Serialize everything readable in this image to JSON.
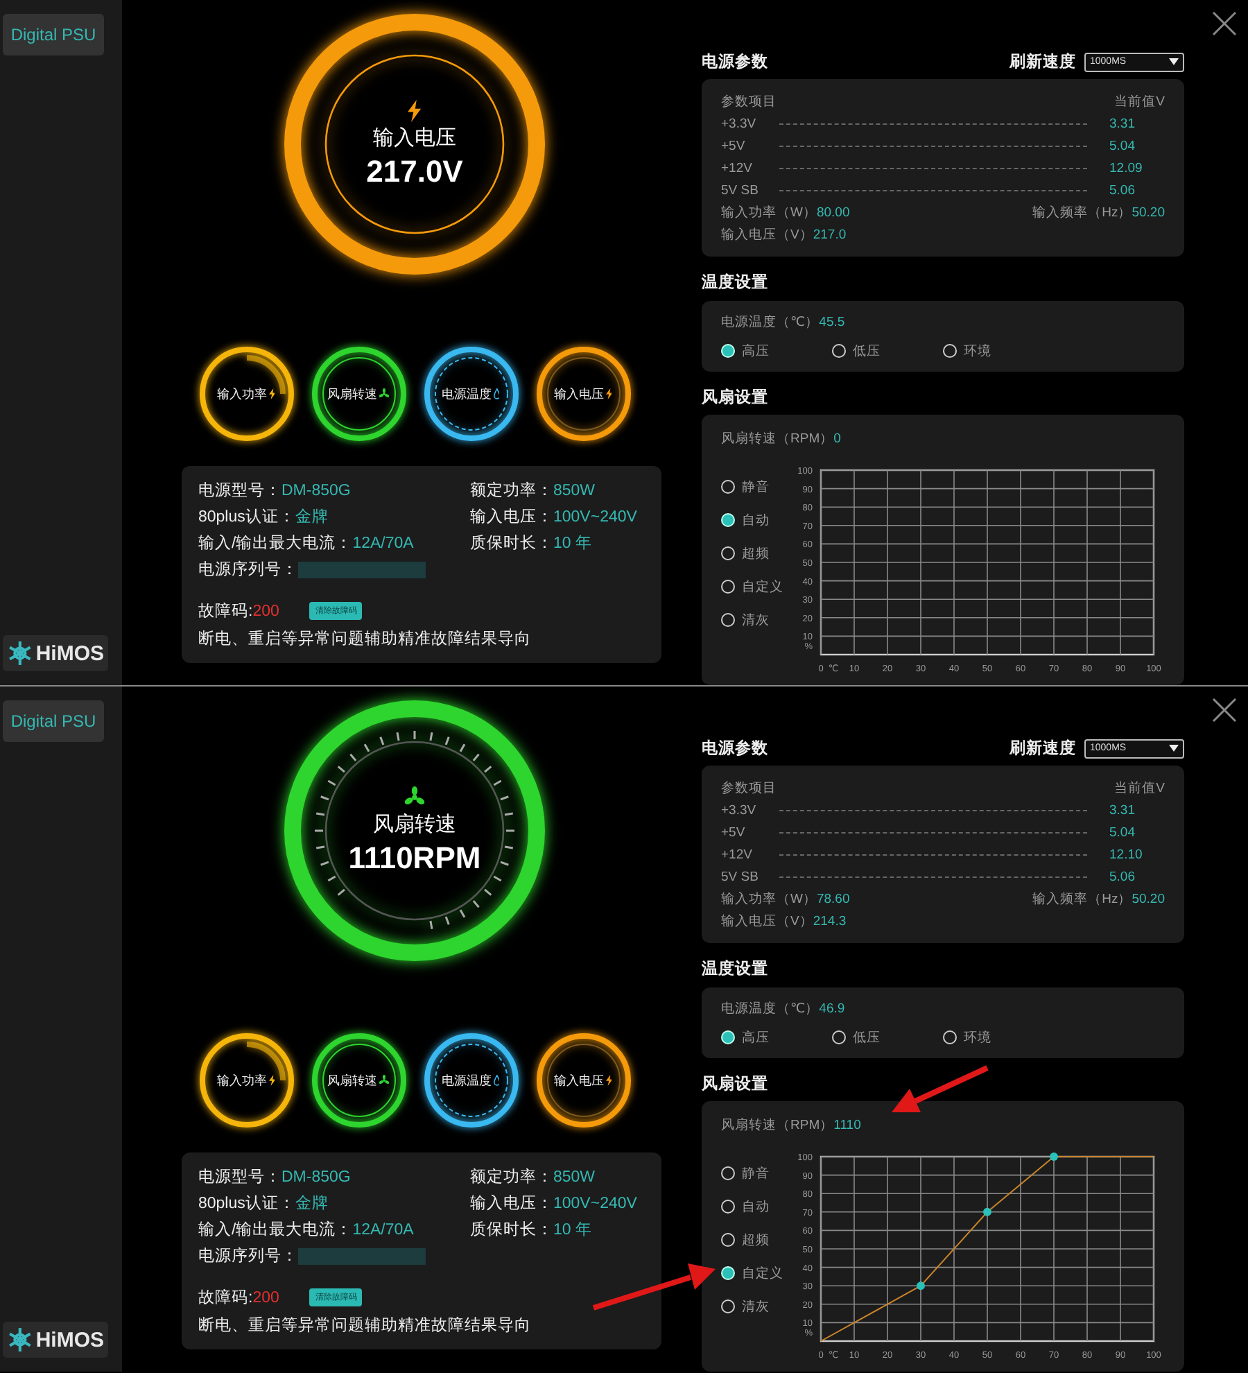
{
  "panels": [
    {
      "annotated": false,
      "sidebar": {
        "button": "Digital PSU",
        "logo": "HiMOS"
      },
      "big_gauge": {
        "kind": "voltage",
        "label": "输入电压",
        "value": "217.0V"
      },
      "small_gauges": [
        {
          "kind": "power",
          "label": "输入功率",
          "color": "#f5b50a"
        },
        {
          "kind": "fan",
          "label": "风扇转速",
          "color": "#2ed52e"
        },
        {
          "kind": "temperature",
          "label": "电源温度",
          "color": "#3ab8f0"
        },
        {
          "kind": "voltage",
          "label": "输入电压",
          "color": "#f59a0a"
        }
      ],
      "info": {
        "left": [
          {
            "label": "电源型号：",
            "value": "DM-850G"
          },
          {
            "label": "80plus认证：",
            "value": "金牌"
          },
          {
            "label": "输入/输出最大电流：",
            "value": "12A/70A"
          },
          {
            "label": "电源序列号：",
            "kind": "redacted"
          }
        ],
        "right": [
          {
            "label": "额定功率：",
            "value": "850W"
          },
          {
            "label": "输入电压：",
            "value": "100V~240V"
          },
          {
            "label": "质保时长：",
            "value": "10 年"
          }
        ],
        "fault_label": "故障码:",
        "fault_code": "200",
        "clear_button": "清除故障码",
        "note": "断电、重启等异常问题辅助精准故障结果导向"
      },
      "params": {
        "title": "电源参数",
        "refresh_label": "刷新速度",
        "refresh_value": "1000MS",
        "col_item": "参数项目",
        "col_value": "当前值V",
        "rows": [
          {
            "label": "+3.3V",
            "value": "3.31"
          },
          {
            "label": "+5V",
            "value": "5.04"
          },
          {
            "label": "+12V",
            "value": "12.09"
          },
          {
            "label": "5V SB",
            "value": "5.06"
          }
        ],
        "input_power_label": "输入功率（W）",
        "input_power": "80.00",
        "input_freq_label": "输入频率（Hz）",
        "input_freq": "50.20",
        "input_voltage_label": "输入电压（V）",
        "input_voltage": "217.0"
      },
      "temperature": {
        "title": "温度设置",
        "label": "电源温度（℃）",
        "value": "45.5",
        "options": [
          {
            "label": "高压",
            "selected": true
          },
          {
            "label": "低压",
            "selected": false
          },
          {
            "label": "环境",
            "selected": false
          }
        ]
      },
      "fan": {
        "title": "风扇设置",
        "label": "风扇转速（RPM）",
        "value": "0",
        "modes": [
          {
            "label": "静音",
            "selected": false
          },
          {
            "label": "自动",
            "selected": true
          },
          {
            "label": "超频",
            "selected": false
          },
          {
            "label": "自定义",
            "selected": false
          },
          {
            "label": "清灰",
            "selected": false
          }
        ],
        "chart_data": {
          "type": "line",
          "grid": true,
          "xlabel": "℃",
          "ylabel": "%",
          "xlim": [
            0,
            100
          ],
          "ylim": [
            0,
            100
          ],
          "xticks": [
            0,
            10,
            20,
            30,
            40,
            50,
            60,
            70,
            80,
            90,
            100
          ],
          "yticks": [
            10,
            20,
            30,
            40,
            50,
            60,
            70,
            80,
            90,
            100
          ]
        }
      }
    },
    {
      "annotated": true,
      "sidebar": {
        "button": "Digital PSU",
        "logo": "HiMOS"
      },
      "big_gauge": {
        "kind": "fan",
        "label": "风扇转速",
        "value": "1110RPM"
      },
      "small_gauges": [
        {
          "kind": "power",
          "label": "输入功率",
          "color": "#f5b50a"
        },
        {
          "kind": "fan",
          "label": "风扇转速",
          "color": "#2ed52e"
        },
        {
          "kind": "temperature",
          "label": "电源温度",
          "color": "#3ab8f0"
        },
        {
          "kind": "voltage",
          "label": "输入电压",
          "color": "#f59a0a"
        }
      ],
      "info": {
        "left": [
          {
            "label": "电源型号：",
            "value": "DM-850G"
          },
          {
            "label": "80plus认证：",
            "value": "金牌"
          },
          {
            "label": "输入/输出最大电流：",
            "value": "12A/70A"
          },
          {
            "label": "电源序列号：",
            "kind": "redacted"
          }
        ],
        "right": [
          {
            "label": "额定功率：",
            "value": "850W"
          },
          {
            "label": "输入电压：",
            "value": "100V~240V"
          },
          {
            "label": "质保时长：",
            "value": "10 年"
          }
        ],
        "fault_label": "故障码:",
        "fault_code": "200",
        "clear_button": "清除故障码",
        "note": "断电、重启等异常问题辅助精准故障结果导向"
      },
      "params": {
        "title": "电源参数",
        "refresh_label": "刷新速度",
        "refresh_value": "1000MS",
        "col_item": "参数项目",
        "col_value": "当前值V",
        "rows": [
          {
            "label": "+3.3V",
            "value": "3.31"
          },
          {
            "label": "+5V",
            "value": "5.04"
          },
          {
            "label": "+12V",
            "value": "12.10"
          },
          {
            "label": "5V SB",
            "value": "5.06"
          }
        ],
        "input_power_label": "输入功率（W）",
        "input_power": "78.60",
        "input_freq_label": "输入频率（Hz）",
        "input_freq": "50.20",
        "input_voltage_label": "输入电压（V）",
        "input_voltage": "214.3"
      },
      "temperature": {
        "title": "温度设置",
        "label": "电源温度（℃）",
        "value": "46.9",
        "options": [
          {
            "label": "高压",
            "selected": true
          },
          {
            "label": "低压",
            "selected": false
          },
          {
            "label": "环境",
            "selected": false
          }
        ]
      },
      "fan": {
        "title": "风扇设置",
        "label": "风扇转速（RPM）",
        "value": "1110",
        "modes": [
          {
            "label": "静音",
            "selected": false
          },
          {
            "label": "自动",
            "selected": false
          },
          {
            "label": "超频",
            "selected": false
          },
          {
            "label": "自定义",
            "selected": true
          },
          {
            "label": "清灰",
            "selected": false
          }
        ],
        "chart_data": {
          "type": "line",
          "grid": true,
          "xlabel": "℃",
          "ylabel": "%",
          "x": [
            0,
            30,
            50,
            70,
            100
          ],
          "xlim": [
            0,
            100
          ],
          "ylim": [
            0,
            100
          ],
          "xticks": [
            0,
            10,
            20,
            30,
            40,
            50,
            60,
            70,
            80,
            90,
            100
          ],
          "yticks": [
            10,
            20,
            30,
            40,
            50,
            60,
            70,
            80,
            90,
            100
          ],
          "series": [
            {
              "color": "#c8842a",
              "values": [
                0,
                30,
                70,
                100,
                100
              ]
            }
          ]
        }
      }
    }
  ]
}
